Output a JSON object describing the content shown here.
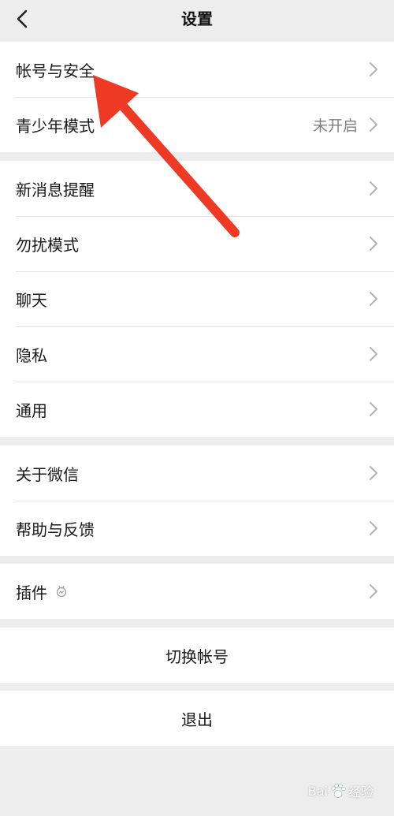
{
  "navbar": {
    "title": "设置"
  },
  "group1": [
    {
      "label": "帐号与安全",
      "value": ""
    },
    {
      "label": "青少年模式",
      "value": "未开启"
    }
  ],
  "group2": [
    {
      "label": "新消息提醒"
    },
    {
      "label": "勿扰模式"
    },
    {
      "label": "聊天"
    },
    {
      "label": "隐私"
    },
    {
      "label": "通用"
    }
  ],
  "group3": [
    {
      "label": "关于微信"
    },
    {
      "label": "帮助与反馈"
    }
  ],
  "group4": [
    {
      "label": "插件"
    }
  ],
  "switch_account": {
    "label": "切换帐号"
  },
  "logout": {
    "label": "退出"
  },
  "annotation": {
    "arrow_color": "#ee3a24"
  },
  "watermark": {
    "text_left": "Bai",
    "text_right": "经验"
  }
}
